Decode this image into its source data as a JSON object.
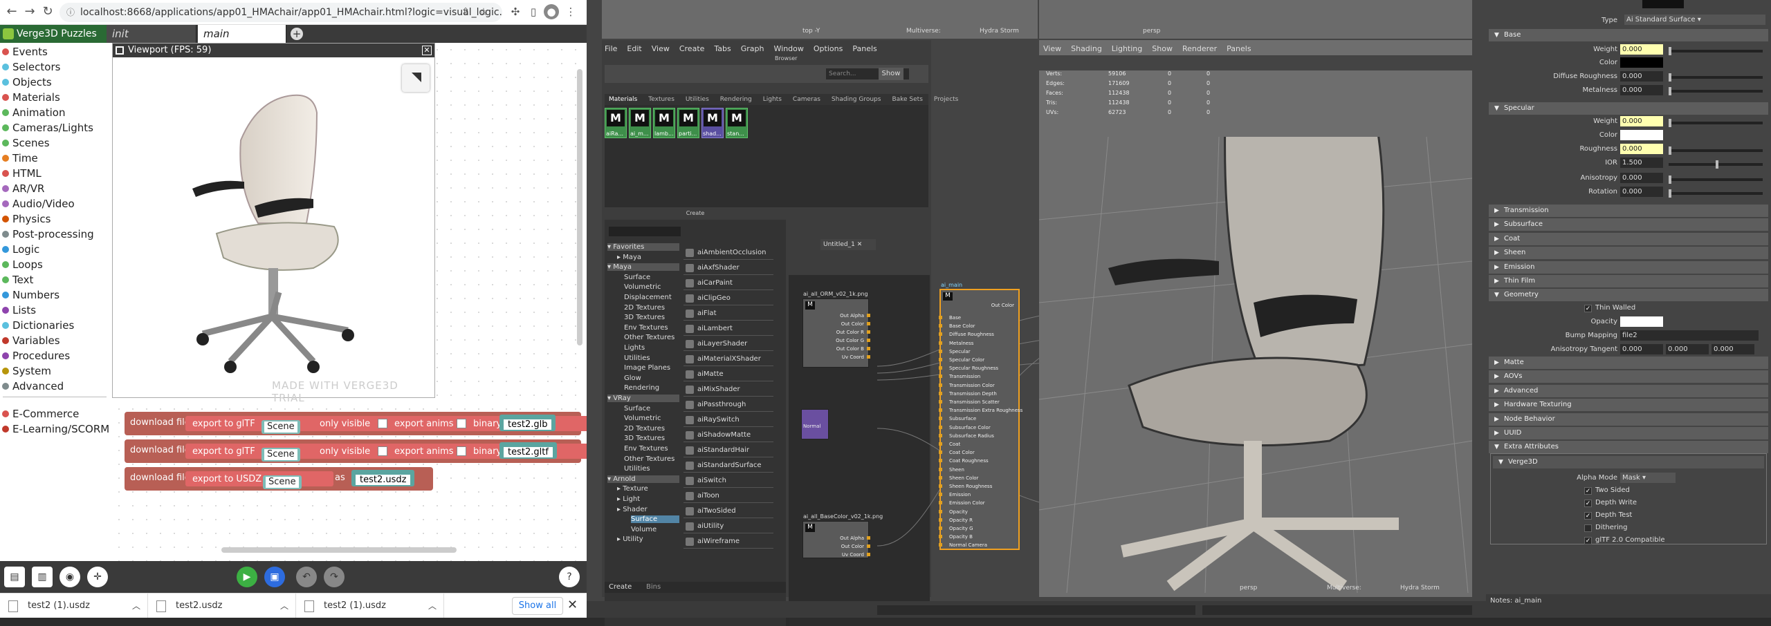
{
  "browser": {
    "url": "localhost:8668/applications/app01_HMAchair/app01_HMAchair.html?logic=visual_logic.xm...",
    "puzzles_title": "Verge3D Puzzles",
    "tabs": [
      "init",
      "main"
    ],
    "categories": [
      {
        "label": "Events",
        "color": "#d9534f"
      },
      {
        "label": "Selectors",
        "color": "#5bc0de"
      },
      {
        "label": "Objects",
        "color": "#5bc0de"
      },
      {
        "label": "Materials",
        "color": "#d9534f"
      },
      {
        "label": "Animation",
        "color": "#5cb85c"
      },
      {
        "label": "Cameras/Lights",
        "color": "#5cb85c"
      },
      {
        "label": "Scenes",
        "color": "#5cb85c"
      },
      {
        "label": "Time",
        "color": "#e67e22"
      },
      {
        "label": "HTML",
        "color": "#d9534f"
      },
      {
        "label": "AR/VR",
        "color": "#a569bd"
      },
      {
        "label": "Audio/Video",
        "color": "#a569bd"
      },
      {
        "label": "Physics",
        "color": "#d35400"
      },
      {
        "label": "Post-processing",
        "color": "#7f8c8d"
      },
      {
        "label": "Logic",
        "color": "#3498db"
      },
      {
        "label": "Loops",
        "color": "#5cb85c"
      },
      {
        "label": "Text",
        "color": "#5cb85c"
      },
      {
        "label": "Numbers",
        "color": "#3498db"
      },
      {
        "label": "Lists",
        "color": "#8e44ad"
      },
      {
        "label": "Dictionaries",
        "color": "#5bc0de"
      },
      {
        "label": "Variables",
        "color": "#c0392b"
      },
      {
        "label": "Procedures",
        "color": "#8e44ad"
      },
      {
        "label": "System",
        "color": "#b7950b"
      },
      {
        "label": "Advanced",
        "color": "#7f8c8d"
      },
      {
        "label": "E-Commerce",
        "color": "#d9534f"
      },
      {
        "label": "E-Learning/SCORM",
        "color": "#c0392b"
      }
    ],
    "viewport_title": "Viewport (FPS: 59)",
    "watermark": "MADE WITH VERGE3D TRIAL",
    "blocks": {
      "download": "download file",
      "export_gltf": "export to glTF",
      "export_usdz": "export to USDZ",
      "scene": "Scene",
      "only_visible": "only visible",
      "export_anims": "export anims",
      "binary": "binary",
      "as": "as",
      "file1": "test2.glb",
      "file2": "test2.gltf",
      "file3": "test2.usdz"
    },
    "downloads": [
      "test2 (1).usdz",
      "test2.usdz",
      "test2 (1).usdz"
    ],
    "show_all": "Show all"
  },
  "maya": {
    "top_view": {
      "label": "top -Y",
      "multiverse": "Multiverse:",
      "hydra": "Hydra Storm"
    },
    "hypershade_menu": [
      "File",
      "Edit",
      "View",
      "Create",
      "Tabs",
      "Graph",
      "Window",
      "Options",
      "Panels"
    ],
    "browser_label": "Browser",
    "show": "Show",
    "search_placeholder": "Search...",
    "hs_tabs": [
      "Materials",
      "Textures",
      "Utilities",
      "Rendering",
      "Lights",
      "Cameras",
      "Shading Groups",
      "Bake Sets",
      "Projects"
    ],
    "materials": [
      "aiRa...",
      "ai_m...",
      "lamb...",
      "parti...",
      "shad...",
      "stan..."
    ],
    "create_label": "Create",
    "tree": [
      {
        "t": "Favorites",
        "h": true
      },
      {
        "t": "Maya",
        "l": 1
      },
      {
        "t": "Maya",
        "h": true
      },
      {
        "t": "Surface",
        "l": 2
      },
      {
        "t": "Volumetric",
        "l": 2
      },
      {
        "t": "Displacement",
        "l": 2
      },
      {
        "t": "2D Textures",
        "l": 2
      },
      {
        "t": "3D Textures",
        "l": 2
      },
      {
        "t": "Env Textures",
        "l": 2
      },
      {
        "t": "Other Textures",
        "l": 2
      },
      {
        "t": "Lights",
        "l": 2
      },
      {
        "t": "Utilities",
        "l": 2
      },
      {
        "t": "Image Planes",
        "l": 2
      },
      {
        "t": "Glow",
        "l": 2
      },
      {
        "t": "Rendering",
        "l": 2
      },
      {
        "t": "VRay",
        "h": true
      },
      {
        "t": "Surface",
        "l": 2
      },
      {
        "t": "Volumetric",
        "l": 2
      },
      {
        "t": "2D Textures",
        "l": 2
      },
      {
        "t": "3D Textures",
        "l": 2
      },
      {
        "t": "Env Textures",
        "l": 2
      },
      {
        "t": "Other Textures",
        "l": 2
      },
      {
        "t": "Utilities",
        "l": 2
      },
      {
        "t": "Arnold",
        "h": true
      },
      {
        "t": "Texture",
        "l": 1
      },
      {
        "t": "Light",
        "l": 1
      },
      {
        "t": "Shader",
        "l": 1
      },
      {
        "t": "Surface",
        "l": 3,
        "sel": true
      },
      {
        "t": "Volume",
        "l": 3
      },
      {
        "t": "Utility",
        "l": 1
      }
    ],
    "shaders": [
      "aiAmbientOcclusion",
      "aiAxfShader",
      "aiCarPaint",
      "aiClipGeo",
      "aiFlat",
      "aiLambert",
      "aiLayerShader",
      "aiMaterialXShader",
      "aiMatte",
      "aiMixShader",
      "aiPassthrough",
      "aiRaySwitch",
      "aiShadowMatte",
      "aiStandardHair",
      "aiStandardSurface",
      "aiSwitch",
      "aiToon",
      "aiTwoSided",
      "aiUtility",
      "aiWireframe"
    ],
    "graph_tab": "Untitled_1",
    "node_orm": {
      "title": "ai_all_ORM_v02_1k.png",
      "ports": [
        "Out Alpha",
        "Out Color",
        "Out Color R",
        "Out Color G",
        "Out Color B",
        "Uv Coord"
      ]
    },
    "node_normal": {
      "ports": [
        "Normal"
      ]
    },
    "node_base": {
      "title": "ai_all_BaseColor_v02_1k.png",
      "ports": [
        "Out Alpha",
        "Out Color",
        "Uv Coord"
      ]
    },
    "node_main": {
      "title": "ai_main",
      "out": "Out Color",
      "ports": [
        "Base",
        "Base Color",
        "Diffuse Roughness",
        "Metalness",
        "Specular",
        "Specular Color",
        "Specular Roughness",
        "Transmission",
        "Transmission Color",
        "Transmission Depth",
        "Transmission Scatter",
        "Transmission Extra Roughness",
        "Subsurface",
        "Subsurface Color",
        "Subsurface Radius",
        "Coat",
        "Coat Color",
        "Coat Roughness",
        "Sheen",
        "Sheen Color",
        "Sheen Roughness",
        "Emission",
        "Emission Color",
        "Opacity",
        "Opacity R",
        "Opacity G",
        "Opacity B",
        "Normal Camera"
      ]
    },
    "bottom_tabs": [
      "Create",
      "Bins"
    ],
    "persp_menu": [
      "View",
      "Shading",
      "Lighting",
      "Show",
      "Renderer",
      "Panels"
    ],
    "stats": [
      {
        "k": "Verts:",
        "a": "59106",
        "b": "0",
        "c": "0"
      },
      {
        "k": "Edges:",
        "a": "171609",
        "b": "0",
        "c": "0"
      },
      {
        "k": "Faces:",
        "a": "112438",
        "b": "0",
        "c": "0"
      },
      {
        "k": "Tris:",
        "a": "112438",
        "b": "0",
        "c": "0"
      },
      {
        "k": "UVs:",
        "a": "62723",
        "b": "0",
        "c": "0"
      }
    ],
    "persp_label": "persp",
    "ae": {
      "type_label": "Type",
      "type_value": "Ai Standard Surface",
      "base": "Base",
      "weight": "Weight",
      "color": "Color",
      "diffuse_roughness": "Diffuse Roughness",
      "metalness": "Metalness",
      "base_weight": "0.000",
      "diffuse_roughness_v": "0.000",
      "metalness_v": "0.000",
      "specular": "Specular",
      "roughness": "Roughness",
      "ior": "IOR",
      "spec_weight": "0.000",
      "spec_rough": "0.000",
      "ior_v": "1.500",
      "anisotropy": "Anisotropy",
      "anisotropy_v": "0.000",
      "rotation": "Rotation",
      "rotation_v": "0.000",
      "sections": [
        "Transmission",
        "Subsurface",
        "Coat",
        "Sheen",
        "Emission",
        "Thin Film"
      ],
      "geometry": "Geometry",
      "thin_walled": "Thin Walled",
      "opacity": "Opacity",
      "bump": "Bump Mapping",
      "bump_v": "file2",
      "anis_tangent": "Anisotropy Tangent",
      "t1": "0.000",
      "t2": "0.000",
      "t3": "0.000",
      "sections2": [
        "Matte",
        "AOVs",
        "Advanced",
        "Hardware Texturing",
        "Node Behavior",
        "UUID",
        "Extra Attributes"
      ],
      "verge": "Verge3D",
      "alpha_mode": "Alpha Mode",
      "alpha_mode_v": "Mask",
      "checks": [
        {
          "t": "Two Sided",
          "on": true
        },
        {
          "t": "Depth Write",
          "on": true
        },
        {
          "t": "Depth Test",
          "on": true
        },
        {
          "t": "Dithering",
          "on": false
        },
        {
          "t": "glTF 2.0 Compatible",
          "on": true
        }
      ],
      "notes": "Notes: ai_main"
    }
  }
}
